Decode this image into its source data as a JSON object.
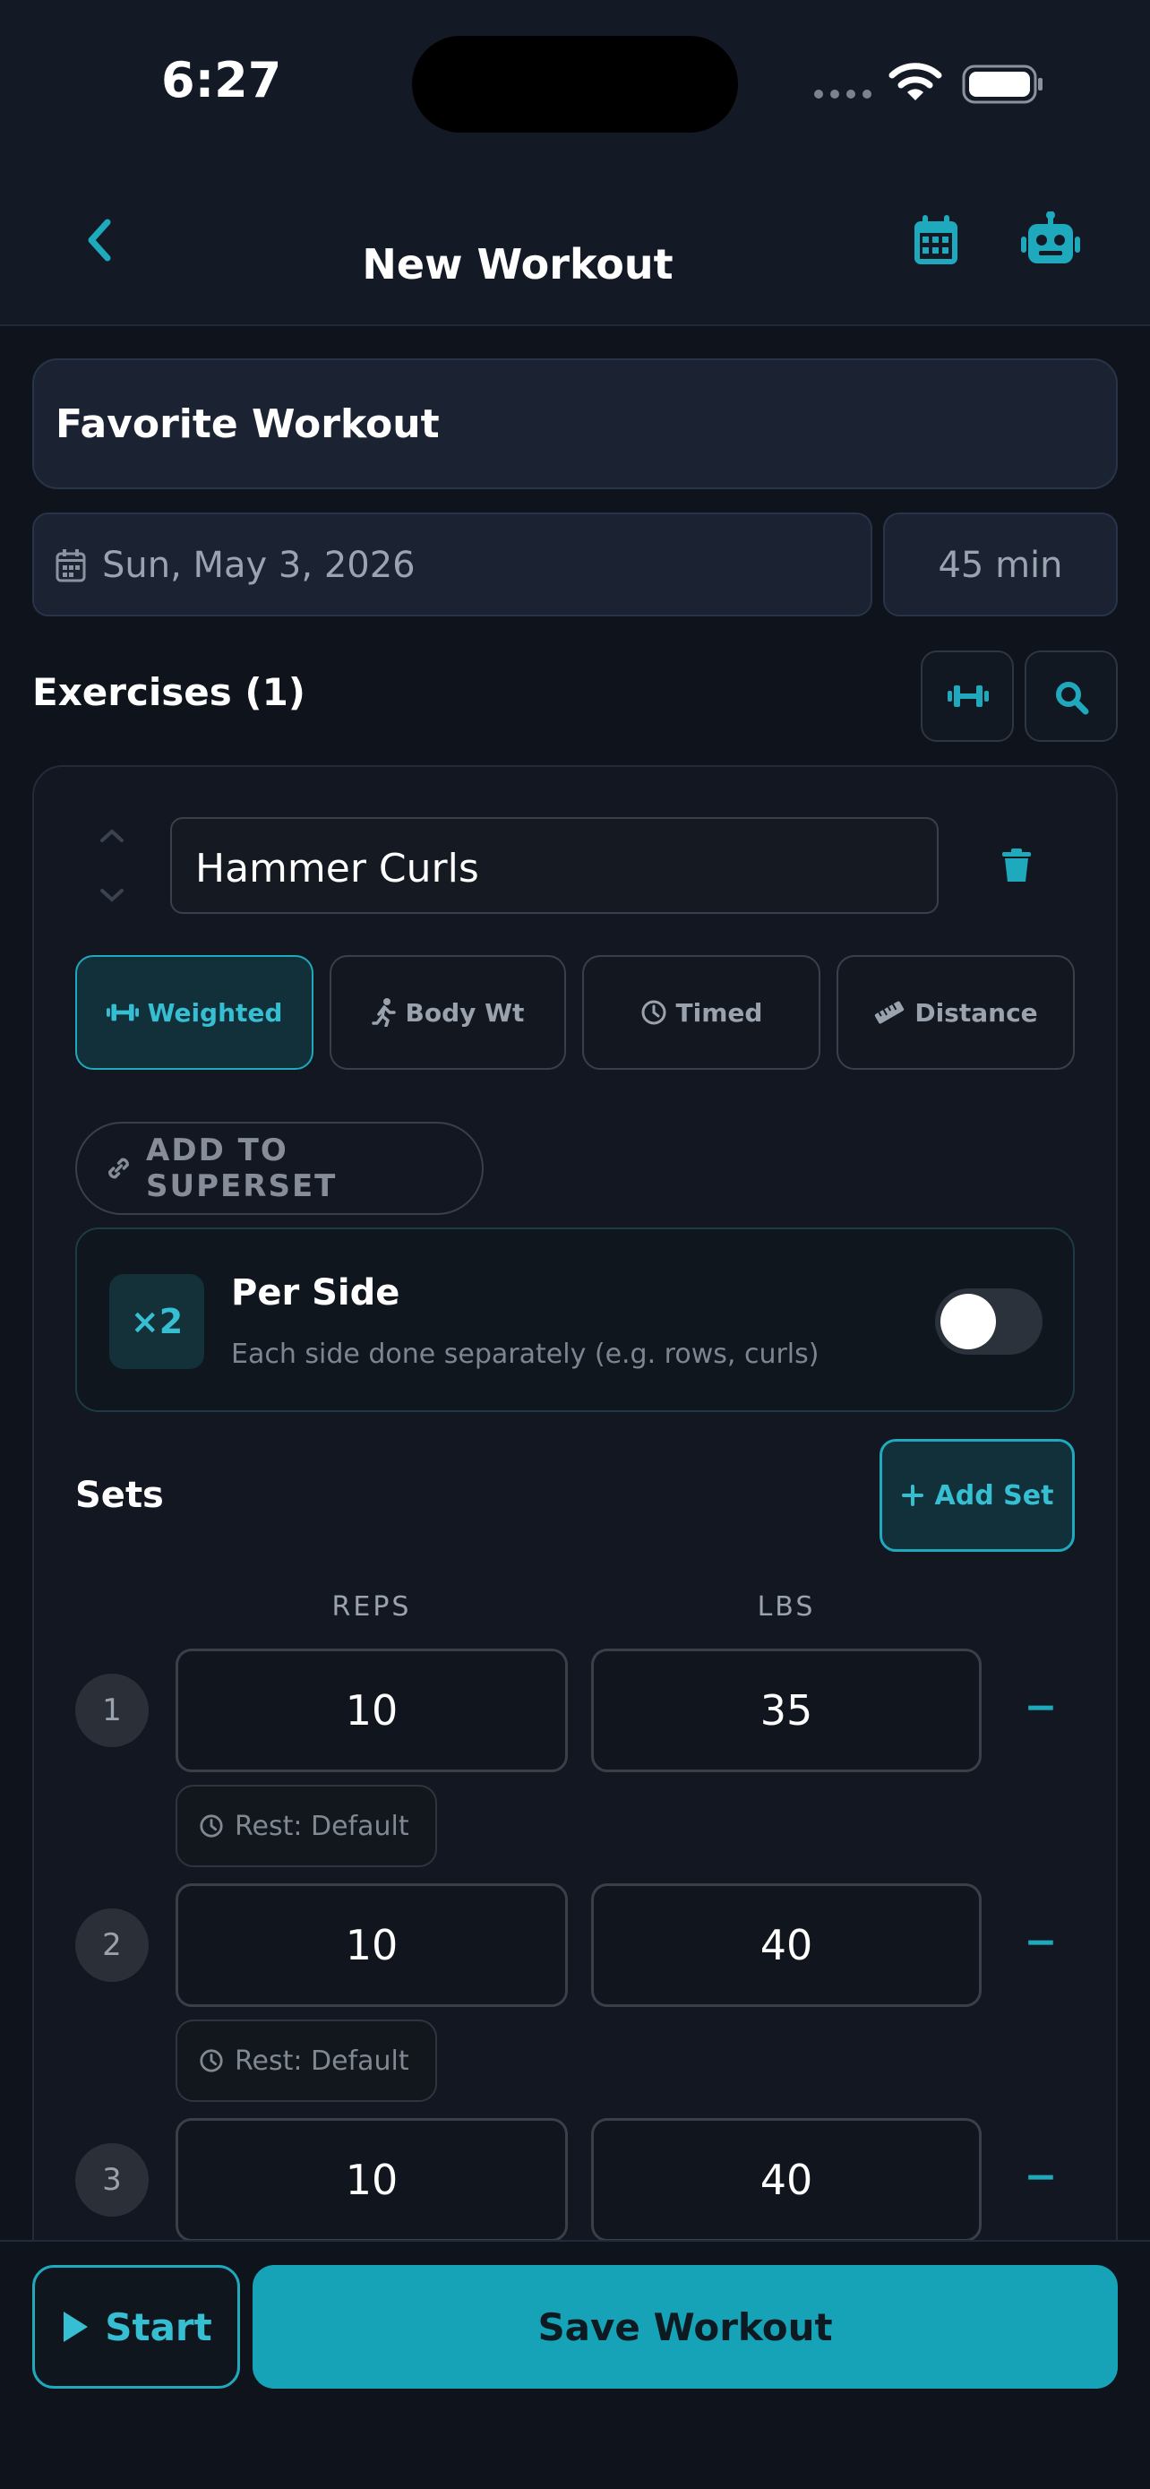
{
  "status_bar": {
    "time": "6:27"
  },
  "header": {
    "title": "New Workout"
  },
  "workout": {
    "name": "Favorite Workout",
    "date": "Sun, May 3, 2026",
    "duration": "45 min"
  },
  "exercises_section": {
    "title": "Exercises (1)"
  },
  "exercise": {
    "name": "Hammer Curls",
    "types": [
      {
        "label": "Weighted",
        "icon": "dumbbell-icon",
        "active": true
      },
      {
        "label": "Body Wt",
        "icon": "running-person-icon",
        "active": false
      },
      {
        "label": "Timed",
        "icon": "clock-icon",
        "active": false
      },
      {
        "label": "Distance",
        "icon": "ruler-icon",
        "active": false
      }
    ],
    "superset_label": "ADD TO SUPERSET",
    "per_side": {
      "badge": "×2",
      "title": "Per Side",
      "subtitle": "Each side done separately (e.g. rows, curls)",
      "enabled": false
    },
    "sets_title": "Sets",
    "add_set_label": "Add Set",
    "columns": {
      "reps": "REPS",
      "weight": "LBS"
    },
    "sets": [
      {
        "number": "1",
        "reps": "10",
        "weight": "35",
        "rest": "Rest: Default"
      },
      {
        "number": "2",
        "reps": "10",
        "weight": "40",
        "rest": "Rest: Default"
      },
      {
        "number": "3",
        "reps": "10",
        "weight": "40"
      }
    ],
    "remove_set_symbol": "−"
  },
  "footer": {
    "start_label": "Start",
    "save_label": "Save Workout"
  },
  "colors": {
    "accent": "#1fa9bd",
    "background": "#0f141c",
    "save_button": "#16a3b8"
  }
}
